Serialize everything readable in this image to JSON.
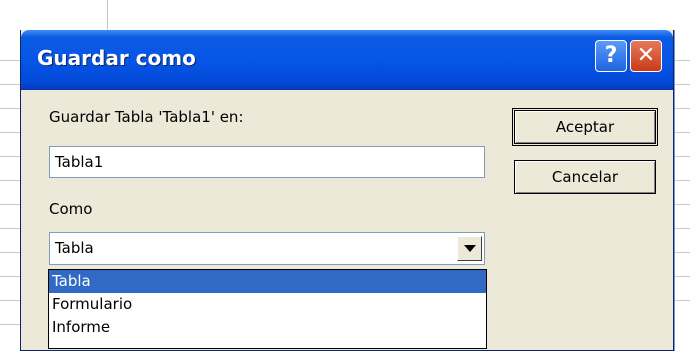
{
  "dialog": {
    "title": "Guardar como",
    "help_glyph": "?",
    "close_glyph": "✕",
    "save_label": "Guardar Tabla 'Tabla1' en:",
    "name_value": "Tabla1",
    "como_label": "Como",
    "como_value": "Tabla",
    "ok_label": "Aceptar",
    "cancel_label": "Cancelar"
  },
  "dropdown": {
    "items": [
      "Tabla",
      "Formulario",
      "Informe"
    ],
    "selected": "Tabla"
  },
  "icons": {
    "help": "help-icon",
    "close": "close-icon",
    "combo_arrow": "chevron-down-icon"
  },
  "colors": {
    "titlebar": "#0556e6",
    "dialog_bg": "#ece9d8",
    "selection": "#316ac5"
  }
}
